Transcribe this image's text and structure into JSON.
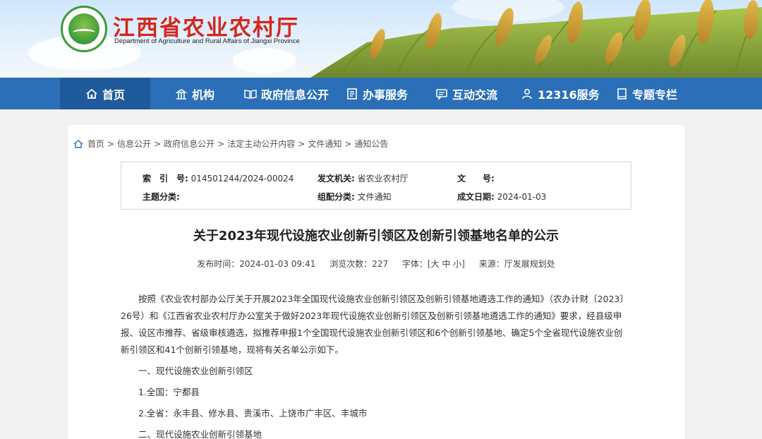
{
  "header": {
    "title": "江西省农业农村厅",
    "subtitle": "Department of Agriculture and Rural Affairs of Jiangxi Province",
    "logo_text": "江西省农业农村厅"
  },
  "nav": {
    "items": [
      {
        "label": "首页",
        "icon": "home-icon",
        "active": true
      },
      {
        "label": "机构",
        "icon": "institution-icon"
      },
      {
        "label": "政府信息公开",
        "icon": "book-open-icon"
      },
      {
        "label": "办事服务",
        "icon": "document-icon"
      },
      {
        "label": "互动交流",
        "icon": "chat-icon"
      },
      {
        "label": "12316服务",
        "icon": "person-service-icon"
      },
      {
        "label": "专题专栏",
        "icon": "book-icon"
      }
    ]
  },
  "breadcrumb": [
    "首页",
    "信息公开",
    "政府信息公开",
    "法定主动公开内容",
    "文件通知",
    "通知公告"
  ],
  "meta": {
    "index_label": "索　引　号:",
    "index_value": "014501244/2024-00024",
    "issuer_label": "发文机关:",
    "issuer_value": "省农业农村厅",
    "docno_label": "文　　号:",
    "docno_value": "",
    "topic_label": "主题分类:",
    "topic_value": "",
    "group_label": "组配分类:",
    "group_value": "文件通知",
    "date_label": "成文日期:",
    "date_value": "2024-01-03"
  },
  "doc": {
    "title": "关于2023年现代设施农业创新引领区及创新引领基地名单的公示",
    "publish_time": "发布时间：2024-01-03 09:41",
    "views": "浏览次数：227",
    "font_size": "字体：[大 中 小]",
    "source": "来源：厅发展规划处",
    "paragraphs": [
      "按照《农业农村部办公厅关于开展2023年全国现代设施农业创新引领区及创新引领基地遴选工作的通知》（农办计财〔2023〕26号）和《江西省农业农村厅办公室关于做好2023年现代设施农业创新引领区及创新引领基地遴选工作的通知》要求，经县级申报、设区市推荐、省级审核遴选，拟推荐申报1个全国现代设施农业创新引领区和6个创新引领基地、确定5个全省现代设施农业创新引领区和41个创新引领基地，现将有关名单公示如下。",
      "一、现代设施农业创新引领区",
      "1.全国：宁都县",
      "2.全省：永丰县、修水县、贵溪市、上饶市广丰区、丰城市",
      "二、现代设施农业创新引领基地"
    ]
  },
  "colors": {
    "nav_bg": "#2a6fb8",
    "nav_active": "#1f5a9c",
    "title_red": "#d6261c"
  }
}
